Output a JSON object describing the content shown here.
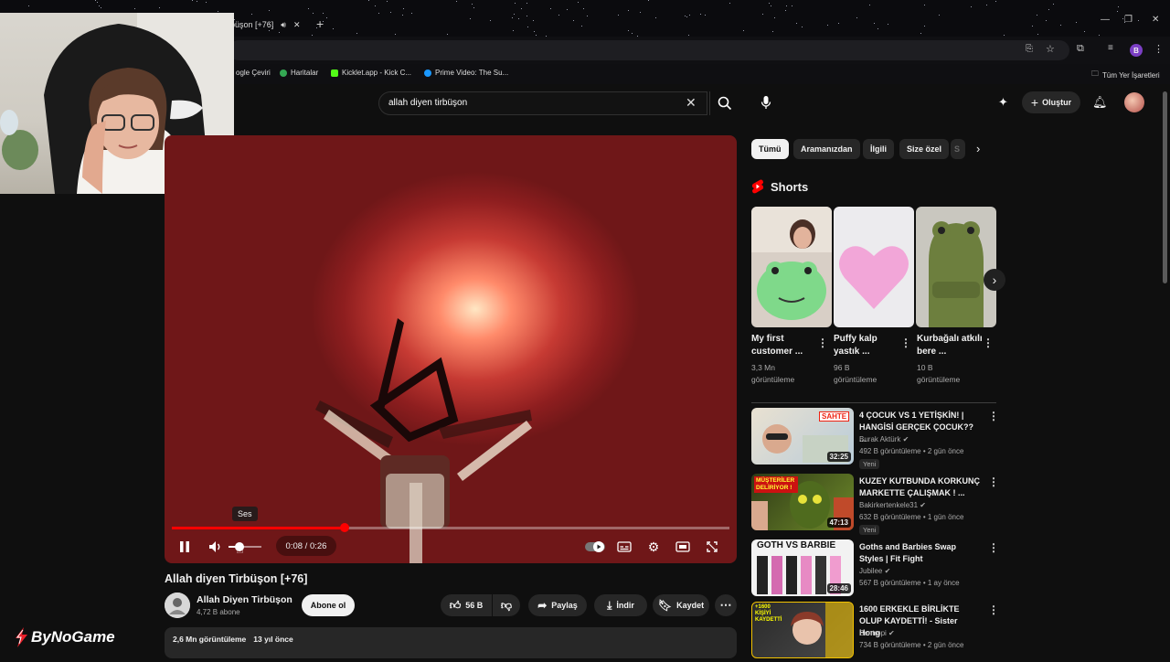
{
  "browser": {
    "tab_title": "büşon [+76]",
    "bookmarks": [
      "ogle Çeviri",
      "Haritalar",
      "Kicklet.app - Kick C...",
      "Prime Video: The Su..."
    ],
    "all_bookmarks": "Tüm Yer İşaretleri",
    "profile_initial": "B"
  },
  "header": {
    "search_query": "allah diyen tirbüşon",
    "create_label": "Oluştur"
  },
  "player": {
    "time": "0:08 / 0:26",
    "tooltip": "Ses",
    "progress": 0.31,
    "volume": 0.33
  },
  "video": {
    "title": "Allah diyen Tirbüşon [+76]",
    "channel": "Allah Diyen Tirbüşon",
    "subscribers": "4,72 B abone",
    "subscribe_label": "Abone ol",
    "likes": "56 B",
    "share_label": "Paylaş",
    "download_label": "İndir",
    "save_label": "Kaydet",
    "views": "2,6 Mn görüntüleme",
    "age": "13 yıl önce"
  },
  "chips": [
    "Tümü",
    "Aramanızdan",
    "İlgili",
    "Size özel",
    "S"
  ],
  "shorts": {
    "header": "Shorts",
    "items": [
      {
        "title": "My first customer ...",
        "views": "3,3 Mn",
        "views_unit": "görüntüleme"
      },
      {
        "title": "Puffy kalp yastık ...",
        "views": "96 B",
        "views_unit": "görüntüleme"
      },
      {
        "title": "Kurbağalı atkılı bere ...",
        "views": "10 B",
        "views_unit": "görüntüleme"
      }
    ]
  },
  "recommended": [
    {
      "title": "4 ÇOCUK VS 1 YETİŞKİN! | HANGİSİ GERÇEK ÇOCUK?? ...",
      "channel": "Burak Aktürk",
      "meta": "492 B görüntüleme • 2 gün önce",
      "badge": "Yeni",
      "duration": "32:25",
      "thumb_text": "SAHTE"
    },
    {
      "title": "KUZEY KUTBUNDA KORKUNÇ MARKETTE ÇALIŞMAK ! ...",
      "channel": "Bakirkertenkele31",
      "meta": "632 B görüntüleme • 1 gün önce",
      "badge": "Yeni",
      "duration": "47:13",
      "thumb_text": "MÜŞTERİLER DELİRİYOR !"
    },
    {
      "title": "Goths and Barbies Swap Styles | Fit Fight",
      "channel": "Jubilee",
      "meta": "567 B görüntüleme • 1 ay önce",
      "badge": "",
      "duration": "28:46",
      "thumb_text": "GOTH VS BARBIE"
    },
    {
      "title": "1600 ERKEKLE BİRLİKTE OLUP KAYDETTİ! - Sister Hong",
      "channel": "Bentropi",
      "meta": "734 B görüntüleme • 2 gün önce",
      "badge": "",
      "duration": "",
      "thumb_text": "+1600 KİŞİYİ KAYDETTİ"
    }
  ],
  "watermark": "ByNoGame",
  "colors": {
    "accent": "#ff0000",
    "background": "#0f0f0f",
    "chip_active": "#f1f1f1"
  }
}
